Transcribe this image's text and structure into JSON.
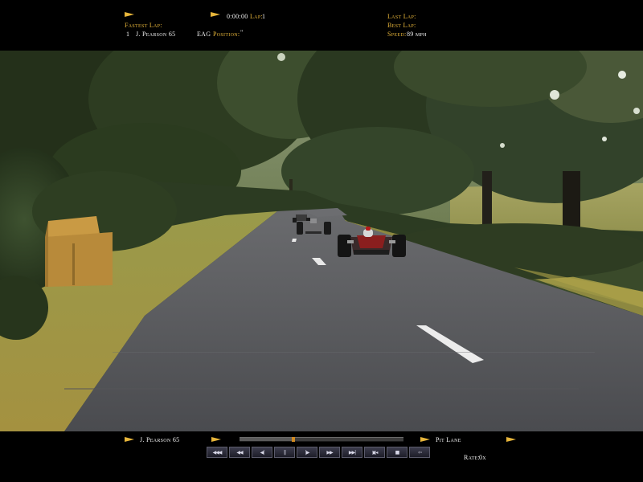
{
  "hud": {
    "timer": "0:00:00",
    "lap_label": "Lap:",
    "lap_value": "1",
    "fastest_lap_label": "Fastest Lap:",
    "fastest_lap_rank": "1",
    "fastest_lap_driver": "J. Pearson 65",
    "team": "EAG",
    "position_label": "Position:",
    "position_value": "\"",
    "last_lap_label": "Last Lap:",
    "best_lap_label": "Best Lap:",
    "speed_label": "Speed:",
    "speed_value": "89 mph"
  },
  "replay": {
    "driver": "J. Pearson 65",
    "location": "Pit Lane",
    "rate_label": "Rate:",
    "rate_value": "0x",
    "progress_percent": 32,
    "buttons": [
      {
        "name": "skip-to-start-button",
        "icon": "◀◀◀"
      },
      {
        "name": "rewind-fast-button",
        "icon": "◀◀"
      },
      {
        "name": "step-back-button",
        "icon": "◀|"
      },
      {
        "name": "pause-button",
        "icon": "||"
      },
      {
        "name": "step-forward-button",
        "icon": "|▶"
      },
      {
        "name": "fast-forward-button",
        "icon": "▶▶"
      },
      {
        "name": "skip-to-end-button",
        "icon": "▶▶|"
      },
      {
        "name": "camera-button",
        "icon": "▣◂"
      },
      {
        "name": "stop-button",
        "icon": "■"
      },
      {
        "name": "exit-button",
        "icon": "⇦"
      }
    ]
  },
  "colors": {
    "hud_gold": "#e7b53a",
    "asphalt": "#5c5d60",
    "grass_verge": "#b4a24a",
    "foliage": "#2f3f22"
  }
}
